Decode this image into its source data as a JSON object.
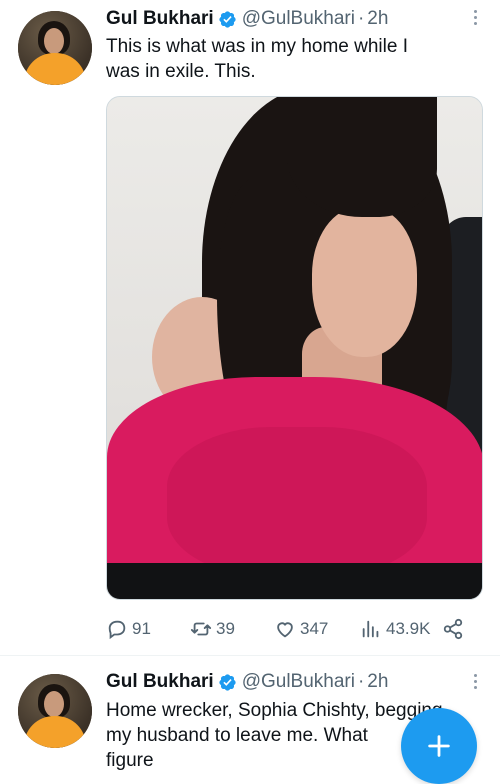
{
  "tweets": [
    {
      "author": {
        "name": "Gul Bukhari",
        "handle": "@GulBukhari",
        "verified": true
      },
      "time": "2h",
      "separator": "·",
      "text_lines": [
        "This is what was in my home while I",
        "was in exile. This."
      ],
      "media": {
        "type": "photo",
        "subject": "photo"
      },
      "stats": {
        "replies": "91",
        "retweets": "39",
        "likes": "347",
        "views": "43.9K"
      }
    },
    {
      "author": {
        "name": "Gul Bukhari",
        "handle": "@GulBukhari",
        "verified": true
      },
      "time": "2h",
      "separator": "·",
      "text_lines": [
        "Home wrecker, Sophia Chishty, begging",
        "my husband to leave me. What",
        "figure"
      ]
    }
  ],
  "icons": {
    "verified": "verified-badge-icon",
    "more": "more-icon",
    "reply": "reply-icon",
    "retweet": "retweet-icon",
    "like": "heart-icon",
    "views": "views-icon",
    "share": "share-icon",
    "compose": "plus-icon"
  },
  "colors": {
    "accent": "#1d9bf0",
    "text": "#0f1419",
    "muted": "#536471"
  }
}
